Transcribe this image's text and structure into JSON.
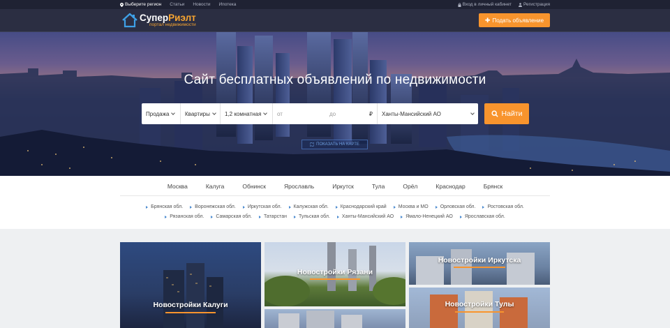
{
  "topbar": {
    "region_label": "Выберите регион",
    "links": [
      "Статьи",
      "Новости",
      "Ипотека"
    ],
    "cabinet_label": "Вход в личный кабинет",
    "register_label": "Регистрация"
  },
  "header": {
    "logo_name_part1": "Супер",
    "logo_name_part2": "Риэлт",
    "logo_tagline": "портал недвижимости",
    "add_button_label": "Подать объявление"
  },
  "hero": {
    "title": "Сайт бесплатных объявлений по недвижимости",
    "search": {
      "deal_type": "Продажа",
      "property_type": "Квартиры",
      "rooms": "1,2 комнатная",
      "price_from_placeholder": "от",
      "price_to_placeholder": "до",
      "currency": "₽",
      "region": "Ханты-Мансийский АО",
      "find_label": "Найти"
    },
    "map_link_label": "ПОКАЗАТЬ НА КАРТЕ"
  },
  "cities": [
    "Москва",
    "Калуга",
    "Обнинск",
    "Ярославль",
    "Иркутск",
    "Тула",
    "Орёл",
    "Краснодар",
    "Брянск"
  ],
  "regions": [
    "Брянская обл.",
    "Воронежская обл.",
    "Иркутская обл.",
    "Калужская обл.",
    "Краснодарский край",
    "Москва и МО",
    "Орловская обл.",
    "Ростовская обл.",
    "Рязанская обл.",
    "Самарская обл.",
    "Татарстан",
    "Тульская обл.",
    "Ханты-Мансийский АО",
    "Ямало-Ненецкий АО",
    "Ярославская обл."
  ],
  "tiles": {
    "kaluga": "Новостройки Калуги",
    "ryazan": "Новостройки Рязани",
    "irkutsk": "Новостройки Иркутска",
    "tula": "Новостройки Тулы"
  },
  "colors": {
    "accent": "#f8942d",
    "topbar": "#1f2233",
    "header": "#2b2e42",
    "link_blue": "#4b8bd0"
  }
}
